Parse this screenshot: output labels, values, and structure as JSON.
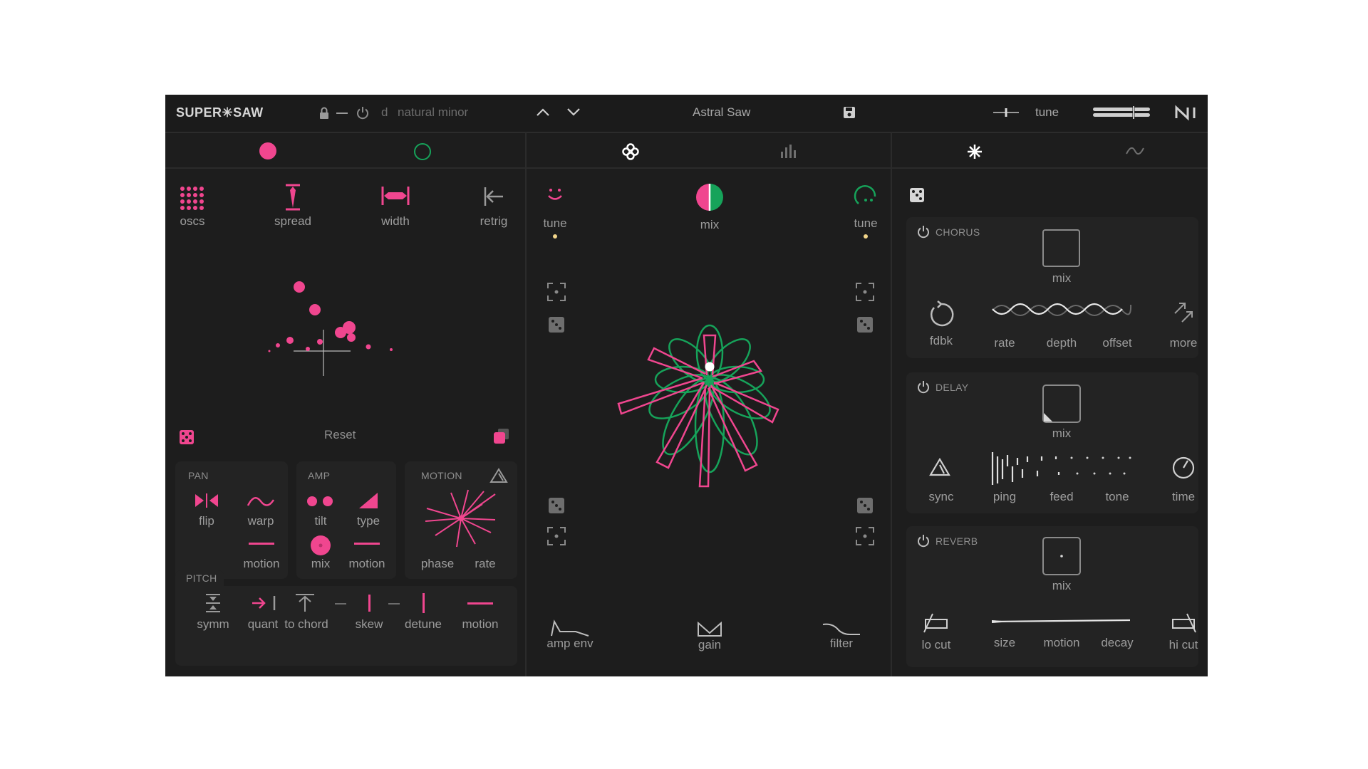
{
  "colors": {
    "pink": "#f0468f",
    "green": "#16a35a",
    "bg": "#1d1d1d",
    "yellow": "#f2d58a"
  },
  "header": {
    "logo": "SUPER✳SAW",
    "key": "d",
    "scale": "natural minor",
    "preset_name": "Astral Saw",
    "tune_label": "tune"
  },
  "left": {
    "top_controls": [
      {
        "icon": "oscs-grid-icon",
        "label": "oscs"
      },
      {
        "icon": "spread-icon",
        "label": "spread"
      },
      {
        "icon": "width-icon",
        "label": "width"
      },
      {
        "icon": "retrig-icon",
        "label": "retrig"
      }
    ],
    "reset_label": "Reset",
    "pan": {
      "header": "PAN",
      "flip": "flip",
      "warp": "warp",
      "motion": "motion"
    },
    "amp": {
      "header": "AMP",
      "tilt": "tilt",
      "type": "type",
      "mix": "mix",
      "motion": "motion"
    },
    "motion": {
      "header": "MOTION",
      "phase": "phase",
      "rate": "rate"
    },
    "pitch": {
      "header": "PITCH",
      "items": [
        "symm",
        "quant",
        "to chord",
        "skew",
        "detune",
        "motion"
      ]
    }
  },
  "center": {
    "tune_left": "tune",
    "mix": "mix",
    "tune_right": "tune",
    "amp_env": "amp env",
    "gain": "gain",
    "filter": "filter"
  },
  "right": {
    "chorus": {
      "header": "CHORUS",
      "mix": "mix",
      "fdbk": "fdbk",
      "rate": "rate",
      "depth": "depth",
      "offset": "offset",
      "more": "more"
    },
    "delay": {
      "header": "DELAY",
      "mix": "mix",
      "sync": "sync",
      "ping": "ping",
      "feed": "feed",
      "tone": "tone",
      "time": "time"
    },
    "reverb": {
      "header": "REVERB",
      "mix": "mix",
      "lo_cut": "lo cut",
      "size": "size",
      "motion": "motion",
      "decay": "decay",
      "hi_cut": "hi cut"
    }
  }
}
